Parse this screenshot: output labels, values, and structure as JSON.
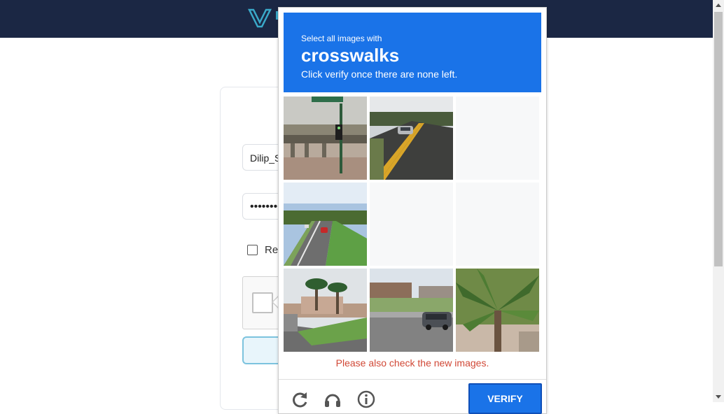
{
  "header": {
    "logo_icon": "v-logo-icon"
  },
  "login_form": {
    "username_value": "Dilip_S",
    "password_value": "••••••••",
    "remember_label": "Rer"
  },
  "recaptcha": {
    "instruction_small": "Select all images with",
    "target_word": "crosswalks",
    "instruction_sub": "Click verify once there are none left.",
    "error_message": "Please also check the new images.",
    "verify_label": "VERIFY",
    "accent_color": "#1a73e8",
    "error_color": "#d14836",
    "footer_icons": [
      "reload-icon",
      "audio-challenge-icon",
      "info-icon"
    ],
    "tiles": [
      {
        "scene": "highway-overpass-with-traffic-light"
      },
      {
        "scene": "two-lane-road-with-car"
      },
      {
        "scene": "loading-blank"
      },
      {
        "scene": "divided-highway-with-cars"
      },
      {
        "scene": "loading-blank"
      },
      {
        "scene": "loading-blank"
      },
      {
        "scene": "road-with-palm-trees-and-building"
      },
      {
        "scene": "street-with-parked-car"
      },
      {
        "scene": "palm-tree-closeup"
      }
    ]
  }
}
